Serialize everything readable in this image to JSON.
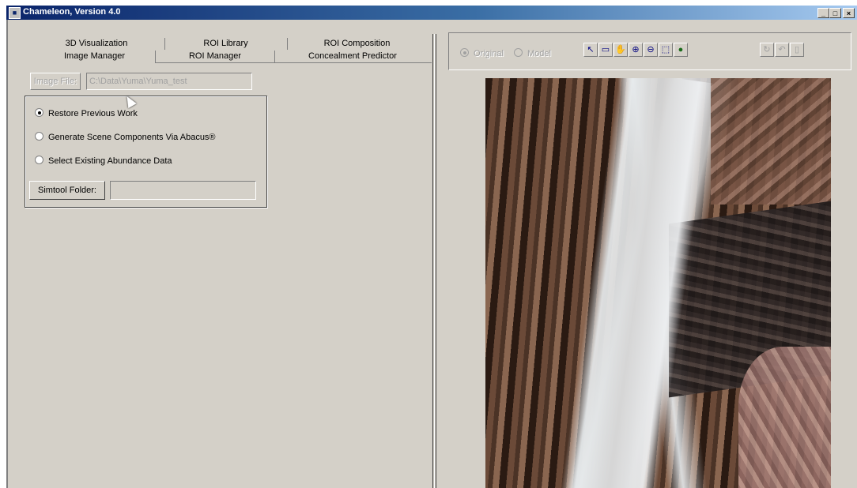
{
  "window": {
    "title": "Chameleon, Version 4.0",
    "minimize": "_",
    "maximize": "□",
    "close": "×"
  },
  "tabs": {
    "row1": [
      "3D Visualization",
      "ROI Library",
      "ROI Composition"
    ],
    "row2": [
      "Image Manager",
      "ROI Manager",
      "Concealment Predictor"
    ],
    "active": "Image Manager"
  },
  "image_manager": {
    "image_file_button": "Image File:",
    "image_file_path": "C:\\Data\\Yuma\\Yuma_test",
    "options": [
      {
        "label": "Restore Previous Work",
        "selected": true
      },
      {
        "label": "Generate Scene Components Via Abacus®",
        "selected": false
      },
      {
        "label": "Select Existing Abundance Data",
        "selected": false
      }
    ],
    "simtool_button": "Simtool Folder:",
    "simtool_path": ""
  },
  "viewer": {
    "mode_original": "Original",
    "mode_model": "Model",
    "mode_selected": "Original",
    "tools": [
      {
        "name": "pointer-icon",
        "glyph": "↖",
        "enabled": true
      },
      {
        "name": "select-rect-icon",
        "glyph": "▭",
        "enabled": true
      },
      {
        "name": "pan-hand-icon",
        "glyph": "✋",
        "enabled": true
      },
      {
        "name": "zoom-in-icon",
        "glyph": "⊕",
        "enabled": true
      },
      {
        "name": "zoom-out-icon",
        "glyph": "⊖",
        "enabled": true
      },
      {
        "name": "zoom-extent-icon",
        "glyph": "⬚",
        "enabled": true
      },
      {
        "name": "globe-icon",
        "glyph": "●",
        "enabled": true
      },
      {
        "name": "rotate-icon",
        "glyph": "↻",
        "enabled": false
      },
      {
        "name": "undo-icon",
        "glyph": "↶",
        "enabled": false
      },
      {
        "name": "document-icon",
        "glyph": "▯",
        "enabled": false
      }
    ]
  }
}
